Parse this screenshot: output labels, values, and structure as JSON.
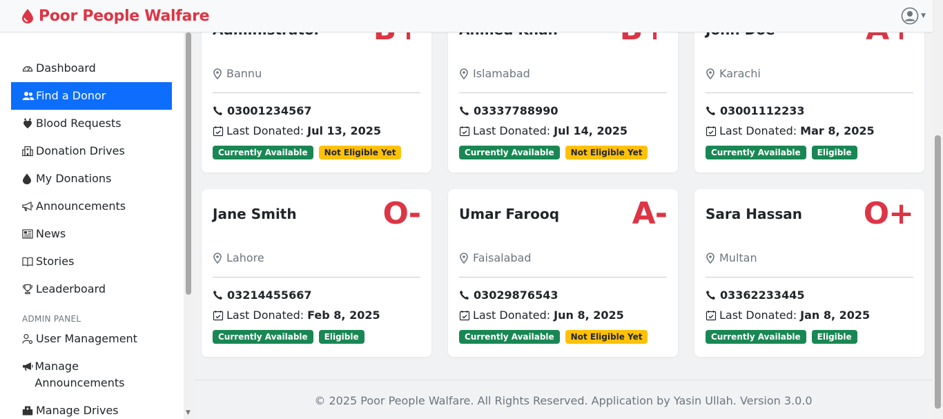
{
  "brand": {
    "name": "Poor People Walfare",
    "color": "#dc3545"
  },
  "sidebar": {
    "items": [
      {
        "label": "Dashboard",
        "icon": "dashboard-icon",
        "active": false
      },
      {
        "label": "Find a Donor",
        "icon": "people-icon",
        "active": true
      },
      {
        "label": "Blood Requests",
        "icon": "heart-drop-icon",
        "active": false
      },
      {
        "label": "Donation Drives",
        "icon": "hospital-icon",
        "active": false
      },
      {
        "label": "My Donations",
        "icon": "droplet-icon",
        "active": false
      },
      {
        "label": "Announcements",
        "icon": "megaphone-icon",
        "active": false
      },
      {
        "label": "News",
        "icon": "newspaper-icon",
        "active": false
      },
      {
        "label": "Stories",
        "icon": "book-icon",
        "active": false
      },
      {
        "label": "Leaderboard",
        "icon": "trophy-icon",
        "active": false
      }
    ],
    "admin_heading": "ADMIN PANEL",
    "admin_items": [
      {
        "label": "User Management",
        "icon": "user-gear-icon"
      },
      {
        "label": "Manage Announcements",
        "icon": "megaphone-fill-icon"
      },
      {
        "label": "Manage Drives",
        "icon": "hospital-fill-icon"
      }
    ]
  },
  "donors": [
    {
      "name": "Administrator",
      "blood": "B+",
      "location": "Bannu",
      "phone": "03001234567",
      "last_label": "Last Donated:",
      "last_date": "Jul 13, 2025",
      "status": "Currently Available",
      "eligibility": "Not Eligible Yet",
      "eligible": false
    },
    {
      "name": "Ahmed Khan",
      "blood": "B+",
      "location": "Islamabad",
      "phone": "03337788990",
      "last_label": "Last Donated:",
      "last_date": "Jul 14, 2025",
      "status": "Currently Available",
      "eligibility": "Not Eligible Yet",
      "eligible": false
    },
    {
      "name": "John Doe",
      "blood": "A+",
      "location": "Karachi",
      "phone": "03001112233",
      "last_label": "Last Donated:",
      "last_date": "Mar 8, 2025",
      "status": "Currently Available",
      "eligibility": "Eligible",
      "eligible": true
    },
    {
      "name": "Jane Smith",
      "blood": "O-",
      "location": "Lahore",
      "phone": "03214455667",
      "last_label": "Last Donated:",
      "last_date": "Feb 8, 2025",
      "status": "Currently Available",
      "eligibility": "Eligible",
      "eligible": true
    },
    {
      "name": "Umar Farooq",
      "blood": "A-",
      "location": "Faisalabad",
      "phone": "03029876543",
      "last_label": "Last Donated:",
      "last_date": "Jun 8, 2025",
      "status": "Currently Available",
      "eligibility": "Not Eligible Yet",
      "eligible": false
    },
    {
      "name": "Sara Hassan",
      "blood": "O+",
      "location": "Multan",
      "phone": "03362233445",
      "last_label": "Last Donated:",
      "last_date": "Jan 8, 2025",
      "status": "Currently Available",
      "eligibility": "Eligible",
      "eligible": true
    }
  ],
  "footer": {
    "text": "© 2025 Poor People Walfare. All Rights Reserved. Application by Yasin Ullah. Version 3.0.0"
  },
  "colors": {
    "accent": "#0d6efd",
    "danger": "#dc3545",
    "success": "#198754",
    "warning": "#ffc107"
  }
}
